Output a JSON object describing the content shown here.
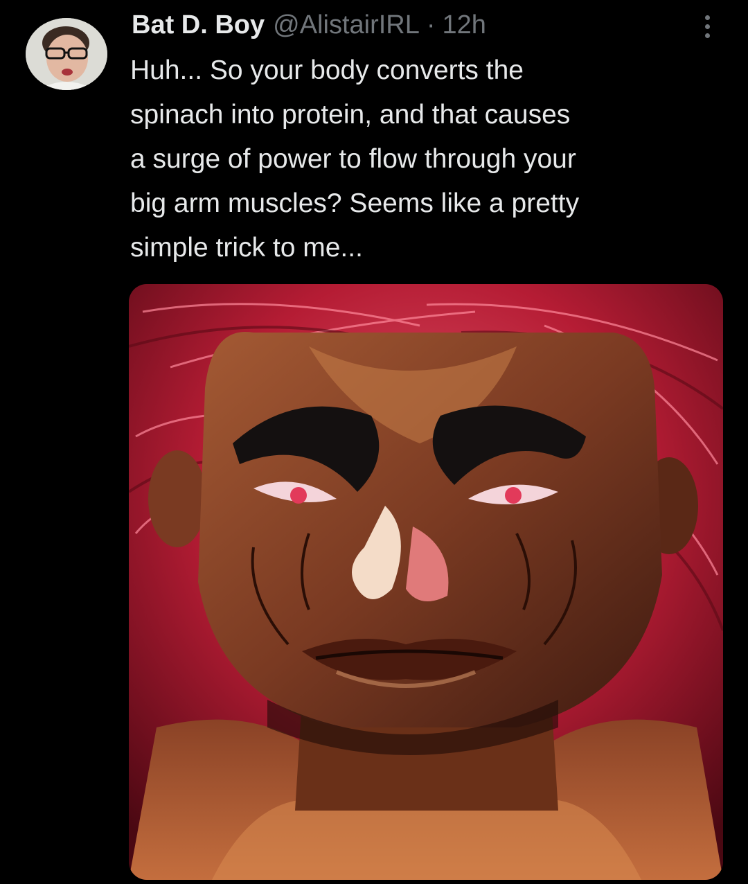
{
  "tweet": {
    "author": {
      "display_name": "Bat D. Boy",
      "handle": "@AlistairIRL",
      "avatar_icon": "user-photo-avatar"
    },
    "separator": "·",
    "timestamp": "12h",
    "more_icon": "more-vertical-icon",
    "text": "Huh... So your body converts the\nspinach into protein, and that causes\na surge of power to flow through your\nbig arm muscles? Seems like a pretty\nsimple trick to me...",
    "media": {
      "type": "image",
      "subject": "anime-character-portrait"
    }
  },
  "colors": {
    "background": "#000000",
    "primary_text": "#e7e9ea",
    "secondary_text": "#71767b",
    "hair_red": "#c21f3a",
    "skin": "#8a4a2c"
  }
}
